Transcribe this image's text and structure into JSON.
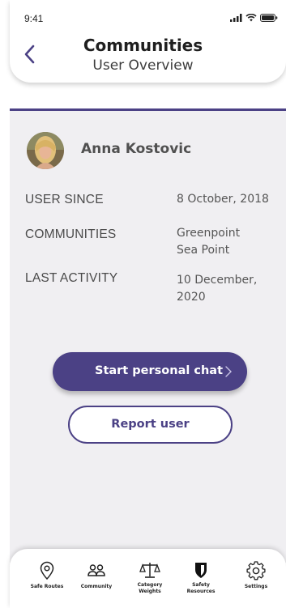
{
  "status_bar": {
    "time": "9:41"
  },
  "header": {
    "title": "Communities",
    "subtitle": "User Overview"
  },
  "user": {
    "name": "Anna Kostovic",
    "details": [
      {
        "label": "USER SINCE",
        "value": "8 October, 2018"
      },
      {
        "label": "COMMUNITIES",
        "value_lines": [
          "Greenpoint",
          "Sea Point"
        ]
      },
      {
        "label": "LAST ACTIVITY",
        "value_lines": [
          "10 December,",
          "2020"
        ]
      }
    ]
  },
  "actions": {
    "chat_label": "Start personal chat",
    "report_label": "Report user"
  },
  "tabs": [
    {
      "label_lines": [
        "Safe Routes"
      ],
      "icon": "location-pin-icon"
    },
    {
      "label_lines": [
        "Community"
      ],
      "icon": "community-icon"
    },
    {
      "label_lines": [
        "Category",
        "Weights"
      ],
      "icon": "scales-icon"
    },
    {
      "label_lines": [
        "Safety",
        "Resources"
      ],
      "icon": "shield-icon"
    },
    {
      "label_lines": [
        "Settings"
      ],
      "icon": "gear-icon"
    }
  ],
  "colors": {
    "accent": "#4b4185",
    "content_bg": "#f0eff2"
  }
}
